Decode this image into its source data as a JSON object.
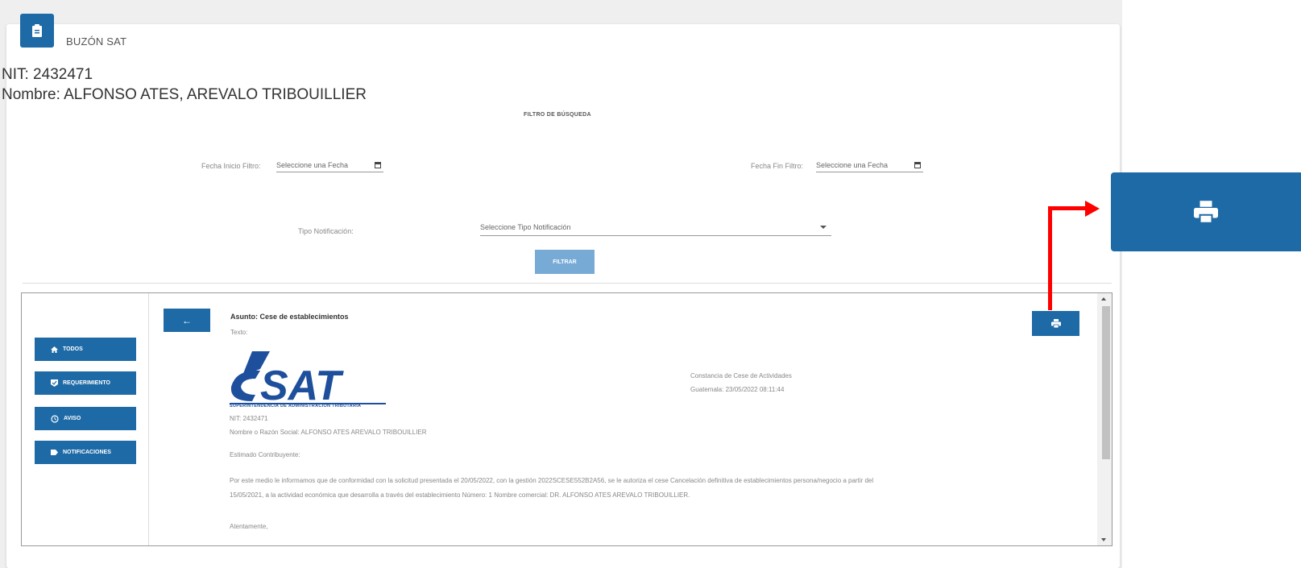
{
  "header": {
    "title": "BUZÓN SAT",
    "icon": "clipboard-icon"
  },
  "taxpayer": {
    "nit": "NIT: 2432471",
    "nombre": "Nombre: ALFONSO ATES, AREVALO TRIBOUILLIER"
  },
  "filter": {
    "title": "FILTRO DE BÚSQUEDA",
    "fecha_inicio_label": "Fecha Inicio Filtro:",
    "fecha_inicio_placeholder": "Seleccione una Fecha",
    "fecha_fin_label": "Fecha Fin Filtro:",
    "fecha_fin_placeholder": "Seleccione una Fecha",
    "tipo_label": "Tipo Notificación:",
    "tipo_placeholder": "Seleccione Tipo Notificación",
    "filtrar_label": "FILTRAR"
  },
  "nav": [
    {
      "label": "TODOS",
      "icon": "home-icon"
    },
    {
      "label": "REQUERIMIENTO",
      "icon": "check-badge-icon"
    },
    {
      "label": "AVISO",
      "icon": "clock-icon"
    },
    {
      "label": "NOTIFICACIONES",
      "icon": "label-icon"
    }
  ],
  "message": {
    "back_label": "←",
    "asunto": "Asunto: Cese de establecimientos",
    "texto_label": "Texto:",
    "logo_text": "SAT",
    "logo_subtitle": "SUPERINTENDENCIA DE ADMINISTRACION TRIBUTARIA",
    "constancia": "Constancia de Cese de Actividades",
    "fecha": "Guatemala: 23/05/2022 08:11:44",
    "nit": "NIT: 2432471",
    "razon_social": "Nombre o Razón Social: ALFONSO ATES AREVALO TRIBOUILLIER",
    "saludo": "Estimado Contribuyente:",
    "parrafo_1": "Por este medio le informamos que de conformidad con la solicitud presentada el 20/05/2022, con la gestión 2022SCESE552B2A56, se le autoriza el cese Cancelación definitiva de establecimientos persona/negocio a partir del",
    "parrafo_2": "15/05/2021, a la actividad económica que desarrolla a través del establecimiento Número: 1 Nombre comercial: DR. ALFONSO ATES AREVALO TRIBOUILLIER.",
    "despedida": "Atentamente,"
  },
  "colors": {
    "primary": "#1e6aa6",
    "filtrar": "#77abd6",
    "arrow": "#ff0000"
  }
}
